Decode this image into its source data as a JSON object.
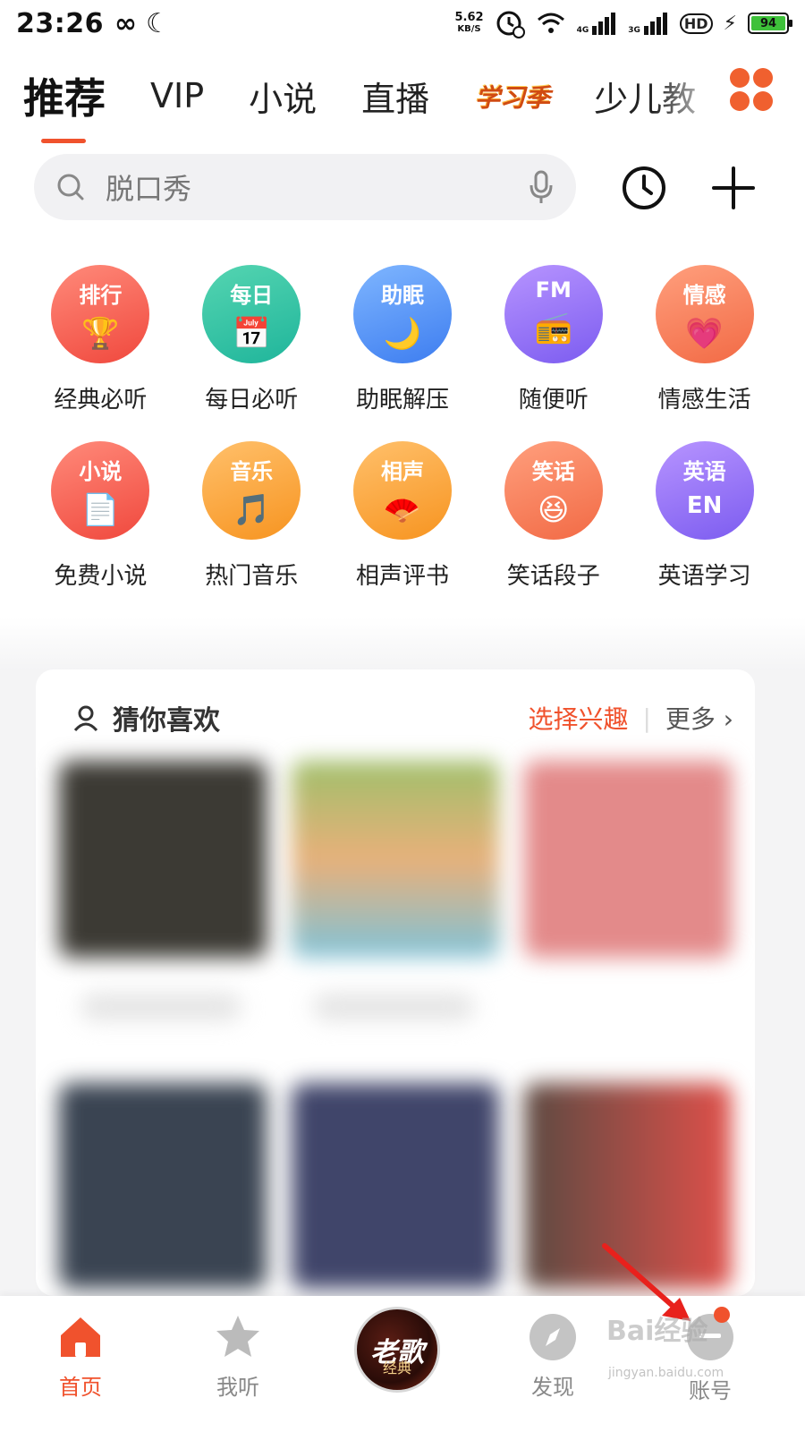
{
  "status_bar": {
    "time": "23:26",
    "net_speed_value": "5.62",
    "net_speed_unit": "KB/S",
    "signal1_label": "4G",
    "signal2_label": "3G",
    "hd_label": "HD",
    "battery": "94"
  },
  "top_tabs": [
    {
      "label": "推荐",
      "active": true
    },
    {
      "label": "VIP"
    },
    {
      "label": "小说"
    },
    {
      "label": "直播"
    },
    {
      "label": "学习季",
      "special": true
    },
    {
      "label": "少儿教"
    }
  ],
  "search": {
    "placeholder": "脱口秀"
  },
  "categories": [
    {
      "badge": "排行",
      "label": "经典必听",
      "color_from": "#ff8a7a",
      "color_to": "#f0483d"
    },
    {
      "badge": "每日",
      "label": "每日必听",
      "color_from": "#55d5b1",
      "color_to": "#1fb59b"
    },
    {
      "badge": "助眠",
      "label": "助眠解压",
      "color_from": "#7fb6ff",
      "color_to": "#3d7df0"
    },
    {
      "badge": "FM",
      "label": "随便听",
      "color_from": "#b794ff",
      "color_to": "#7c5cf0"
    },
    {
      "badge": "情感",
      "label": "情感生活",
      "color_from": "#ff9f7d",
      "color_to": "#f26a45"
    },
    {
      "badge": "小说",
      "label": "免费小说",
      "color_from": "#ff8a7a",
      "color_to": "#f0483d"
    },
    {
      "badge": "音乐",
      "label": "热门音乐",
      "color_from": "#ffc06b",
      "color_to": "#f79420"
    },
    {
      "badge": "相声",
      "label": "相声评书",
      "color_from": "#ffc06b",
      "color_to": "#f79420"
    },
    {
      "badge": "笑话",
      "label": "笑话段子",
      "color_from": "#ff9f7d",
      "color_to": "#f26a45"
    },
    {
      "badge": "英语",
      "label": "英语学习",
      "color_from": "#b794ff",
      "color_to": "#7c5cf0"
    }
  ],
  "feed": {
    "title": "猜你喜欢",
    "interest_label": "选择兴趣",
    "more_label": "更多 ›"
  },
  "bottom_nav": {
    "home": "首页",
    "listen": "我听",
    "center_disc_text": "老歌",
    "center_disc_sub": "经典",
    "discover": "发现",
    "account": "账号"
  },
  "watermark": {
    "text": "Bai经验",
    "sub": "jingyan.baidu.com"
  },
  "colors": {
    "accent": "#f0522d",
    "text": "#222222",
    "muted": "#888888"
  }
}
